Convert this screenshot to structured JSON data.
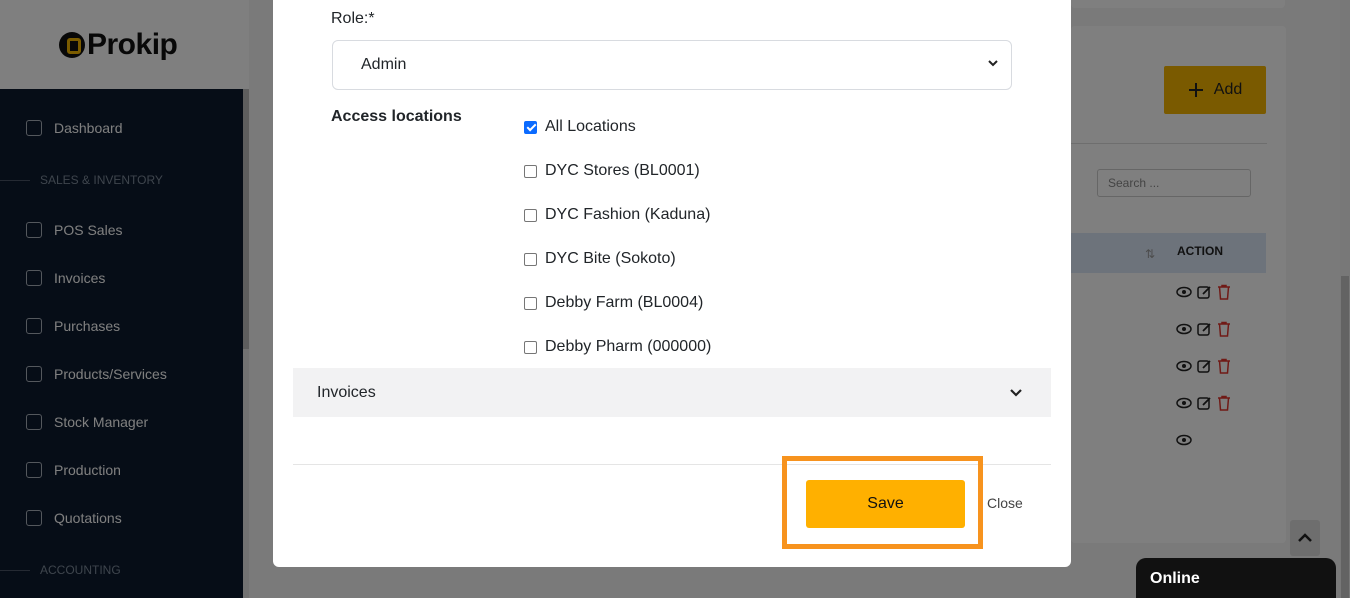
{
  "brand": {
    "logo_text": "Prokip"
  },
  "sidebar": {
    "items": [
      {
        "label": "Dashboard",
        "icon": "home-icon"
      },
      {
        "label": "POS Sales",
        "icon": "bag-icon"
      },
      {
        "label": "Invoices",
        "icon": "invoice-icon"
      },
      {
        "label": "Purchases",
        "icon": "box-icon"
      },
      {
        "label": "Products/Services",
        "icon": "cube-icon"
      },
      {
        "label": "Stock Manager",
        "icon": "folder-icon"
      },
      {
        "label": "Production",
        "icon": "building-icon"
      },
      {
        "label": "Quotations",
        "icon": "doc-icon"
      }
    ],
    "sections": [
      "SALES & INVENTORY",
      "ACCOUNTING"
    ]
  },
  "background": {
    "add_label": "Add",
    "search_placeholder": "Search ...",
    "table_action_header": "ACTION"
  },
  "modal": {
    "role_label": "Role:*",
    "role_value": "Admin",
    "access_label": "Access locations",
    "locations": [
      {
        "label": "All Locations",
        "checked": true
      },
      {
        "label": "DYC Stores (BL0001)",
        "checked": false
      },
      {
        "label": "DYC Fashion (Kaduna)",
        "checked": false
      },
      {
        "label": "DYC Bite (Sokoto)",
        "checked": false
      },
      {
        "label": "Debby Farm (BL0004)",
        "checked": false
      },
      {
        "label": "Debby Pharm (000000)",
        "checked": false
      }
    ],
    "accordion_label": "Invoices",
    "save_label": "Save",
    "close_label": "Close"
  },
  "chat": {
    "status": "Online"
  },
  "colors": {
    "accent": "#ffb000",
    "highlight": "#f7931e",
    "sidebar": "#0d1b2e",
    "checkbox": "#0b6bff"
  }
}
